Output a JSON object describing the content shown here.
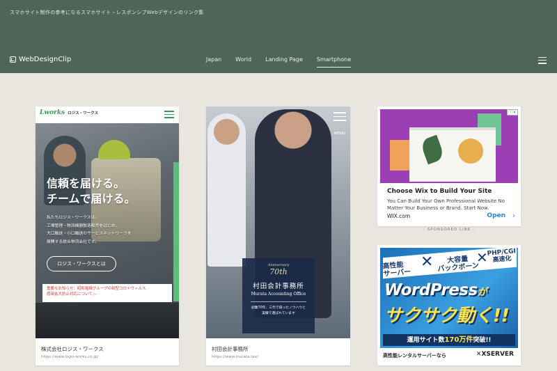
{
  "header": {
    "tagline": "スマホサイト制作の参考になるスマホサイト・レスポンシブWebデザインのリンク集",
    "logo": "WebDesignClip",
    "nav": [
      "Japan",
      "World",
      "Landing Page",
      "Smartphone"
    ],
    "active_nav": "Smartphone",
    "bg_color": "#4f6559"
  },
  "cards": [
    {
      "title": "株式会社ロジス・ワークス",
      "url": "https://www.logis-works.co.jp/",
      "screenshot": {
        "logo": "Lworks",
        "logo_sub": "ロジス・ワークス",
        "headline_1": "信頼を届ける。",
        "headline_2": "チームで届ける。",
        "body": [
          "私たちロジス・ワークスは、",
          "工場管理・物流機器製造販売をはじめ、",
          "大口輸送・小口輸送のサービスネットワークを",
          "展開する総合物流会社です。"
        ],
        "button": "ロジス・ワークスとは",
        "notice": [
          "重要なお知らせ：昭和電線グループの新型コロナウィルス",
          "感染拡大防止対応について ▷"
        ]
      }
    },
    {
      "title": "村田会計事務所",
      "url": "https://www.murata.tax/",
      "screenshot": {
        "menu": "MENU",
        "anniversary": "Anniversary",
        "years": "70th",
        "name": "村田会計事務所",
        "name_en": "Murata Accounting Office",
        "desc": [
          "創業70年、三代で培ったノウハウと",
          "実績で選ばれています"
        ]
      }
    }
  ],
  "ads": {
    "wix": {
      "title": "Choose Wix to Build Your Site",
      "desc": "You Can Build Your Own Professional Website No Matter Your Business or Brand. Start Now.",
      "domain": "WIX.com",
      "cta": "Open",
      "chevron": "›",
      "close": "ⓘ✕"
    },
    "sponsored": "- SPONSORED LINK -",
    "xserver": {
      "t1a": "高性能",
      "t1b": "サーバー",
      "x": "✕",
      "t2a": "大容量",
      "t2b": "バックボーン",
      "t3a": "PHP/CGI",
      "t3b": "高速化",
      "wp": "WordPress",
      "ga": "が",
      "big1": "サクサク",
      "big2": "動く!!",
      "bar_pre": "運用サイト数",
      "bar_num": "170万件",
      "bar_post": "突破!!",
      "foot": "高性能レンタルサーバーなら",
      "brand": "✕XSERVER"
    }
  }
}
